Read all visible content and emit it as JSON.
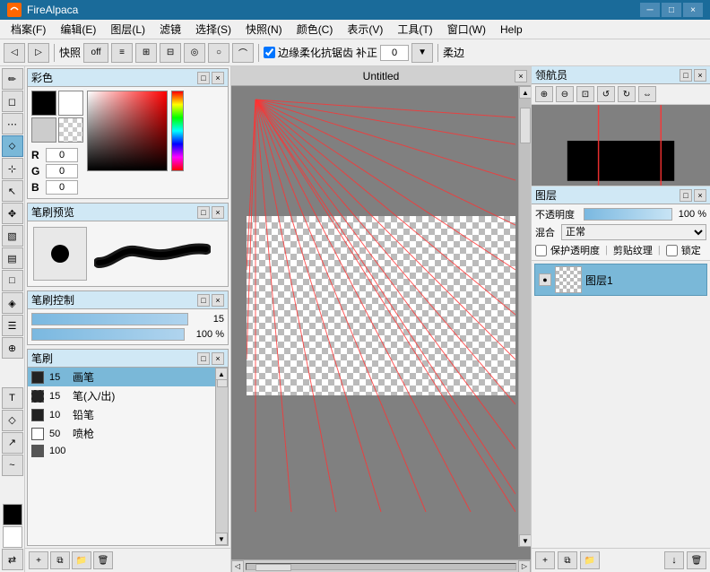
{
  "app": {
    "title": "FireAlpaca",
    "icon_text": "FA"
  },
  "titlebar": {
    "title": "FireAlpaca",
    "minimize": "─",
    "maximize": "□",
    "close": "×"
  },
  "menubar": {
    "items": [
      "档案(F)",
      "编辑(E)",
      "图层(L)",
      "滤镜",
      "选择(S)",
      "快照(N)",
      "颜色(C)",
      "表示(V)",
      "工具(T)",
      "窗口(W)",
      "Help"
    ]
  },
  "toolbar": {
    "quick_label": "快照",
    "quick_off": "off",
    "antialias_label": "边缘柔化抗锯齿",
    "correction_label": "补正",
    "correction_value": "0",
    "soft_edge_label": "柔边",
    "snap_button": "▶▶"
  },
  "color_panel": {
    "title": "彩色",
    "r_label": "R",
    "g_label": "G",
    "b_label": "B",
    "r_value": "0",
    "g_value": "0",
    "b_value": "0"
  },
  "brush_preview_panel": {
    "title": "笔刷预览"
  },
  "brush_control_panel": {
    "title": "笔刷控制",
    "size_value": "15",
    "opacity_value": "100 %"
  },
  "brush_list_panel": {
    "title": "笔刷",
    "items": [
      {
        "size": "15",
        "name": "画笔",
        "selected": true
      },
      {
        "size": "15",
        "name": "笔(入/出)",
        "selected": false
      },
      {
        "size": "10",
        "name": "铅笔",
        "selected": false
      },
      {
        "size": "50",
        "name": "喷枪",
        "selected": false
      },
      {
        "size": "100",
        "name": "",
        "selected": false
      }
    ]
  },
  "canvas": {
    "title": "Untitled"
  },
  "navigator_panel": {
    "title": "领航员"
  },
  "layers_panel": {
    "title": "图层",
    "opacity_label": "不透明度",
    "opacity_value": "100 %",
    "blend_label": "混合",
    "blend_value": "正常",
    "protect_label": "保护透明度",
    "clip_label": "剪贴纹理",
    "lock_label": "锁定",
    "layer_name": "图层1"
  }
}
